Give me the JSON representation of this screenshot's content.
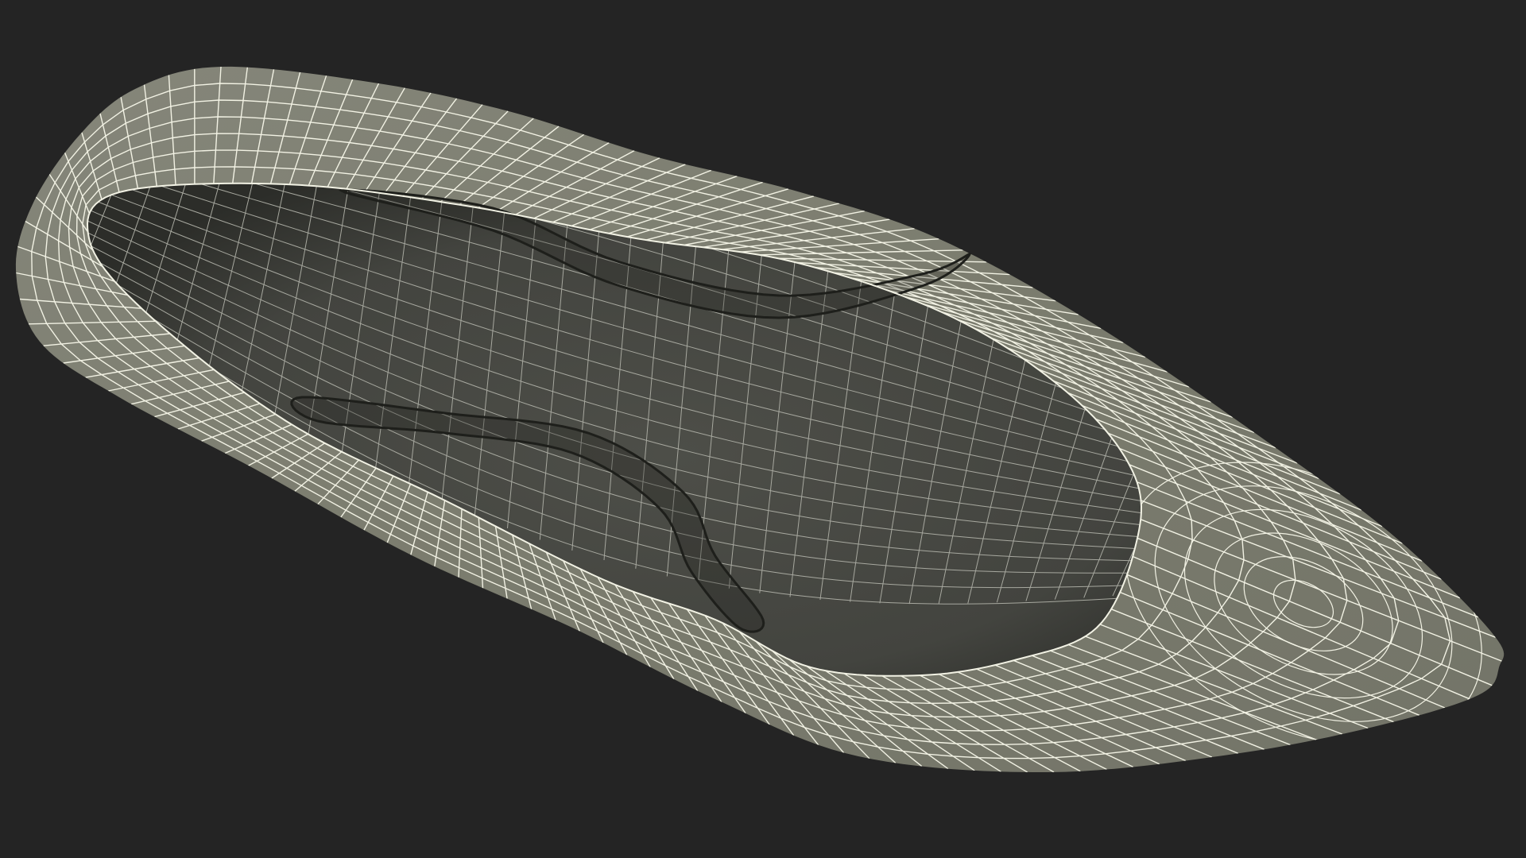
{
  "scene": {
    "subject_icon": "shoe-wireframe-icon",
    "colors": {
      "background": "#242424",
      "outer_surface": "#7b7c6e",
      "outer_highlight": "#8a8b7d",
      "inner_surface": "#474843",
      "inner_shadow": "#2f302c",
      "wire_outer": "#f2f2e4",
      "wire_inner": "#a7a89f",
      "seam": "#1e1f1b"
    }
  }
}
